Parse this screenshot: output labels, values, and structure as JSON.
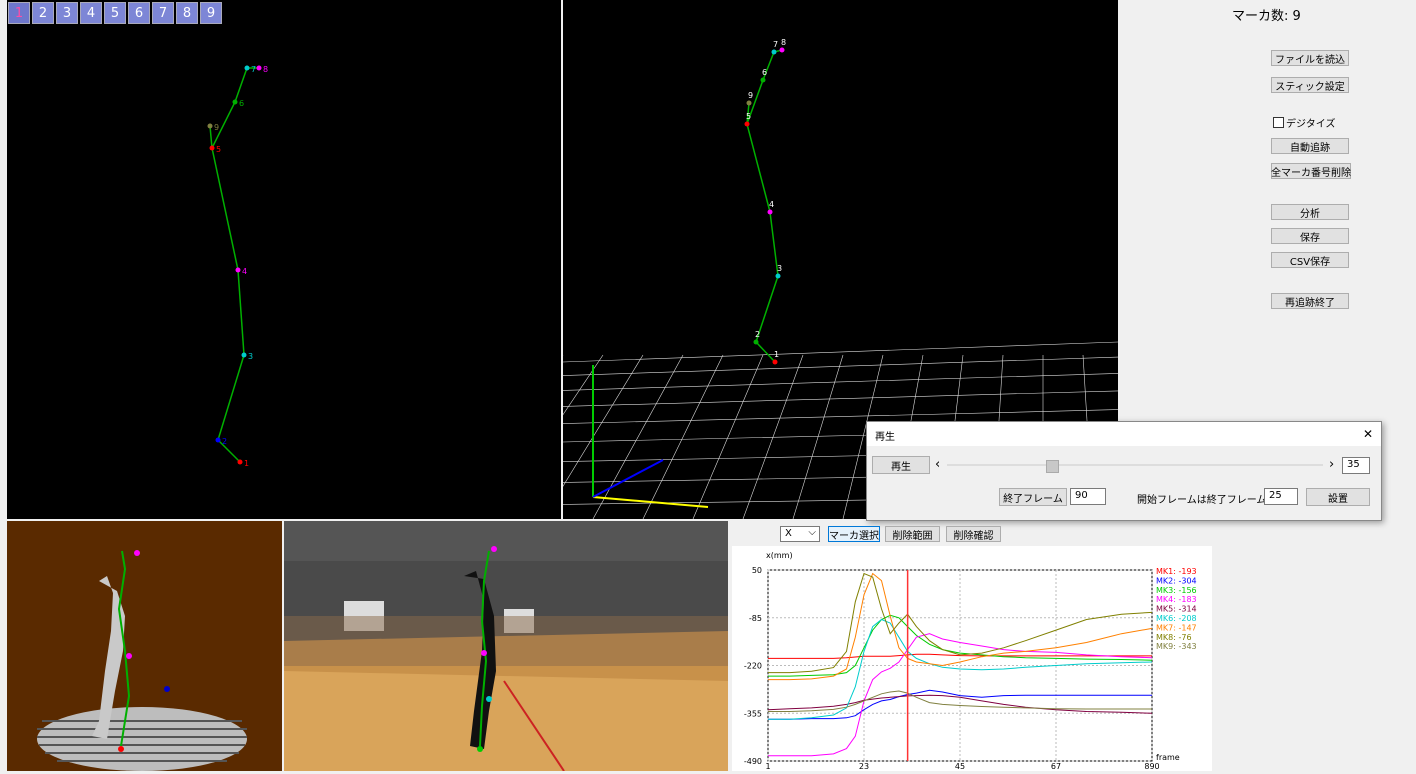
{
  "tabs": [
    "1",
    "2",
    "3",
    "4",
    "5",
    "6",
    "7",
    "8",
    "9"
  ],
  "active_tab": 0,
  "marker_count": {
    "label": "マーカ数:",
    "value": "9"
  },
  "right_panel": {
    "load_file": "ファイルを読込",
    "stick_settings": "スティック設定",
    "digitize_label": "デジタイズ",
    "auto_track": "自動追跡",
    "delete_all_markers": "全マーカ番号削除",
    "analyze": "分析",
    "save": "保存",
    "csv_save": "CSV保存",
    "end_replay": "再追跡終了"
  },
  "playback_dialog": {
    "title": "再生",
    "close": "✕",
    "play_button": "再生",
    "slider_left": "‹",
    "slider_right": "›",
    "slider_value": "35",
    "slider_fraction": 0.27,
    "end_frame_button": "終了フレーム",
    "end_frame_value": "90",
    "start_label": "開始フレームは終了フレーム前",
    "start_value": "25",
    "set_button": "設置"
  },
  "chart_toolbar": {
    "axis_select": "X",
    "marker_select": "マーカ選択",
    "delete_range": "削除範囲",
    "delete_confirm": "削除確認"
  },
  "colors": {
    "mk1": "#ff0000",
    "mk2": "#0000ff",
    "mk3": "#00cc00",
    "mk4": "#ff00ff",
    "mk5": "#800040",
    "mk6": "#00cccc",
    "mk7": "#ff8000",
    "mk8": "#808000",
    "mk9": "#808040",
    "stick": "#00b000"
  },
  "chart_data": {
    "type": "line",
    "ylabel": "x(mm)",
    "xlabel": "frame",
    "x_ticks": [
      "1",
      "23",
      "45",
      "67",
      "890"
    ],
    "y_ticks": [
      50,
      -85,
      -220,
      -355,
      -490
    ],
    "ylim": [
      -490,
      50
    ],
    "x": [
      1,
      6,
      11,
      16,
      19,
      21,
      23,
      25,
      27,
      29,
      31,
      33,
      35,
      38,
      41,
      45,
      50,
      55,
      60,
      67,
      74,
      82,
      89
    ],
    "cursor_frame": 33,
    "legend": [
      {
        "name": "MK1",
        "value": "-193"
      },
      {
        "name": "MK2",
        "value": "-304"
      },
      {
        "name": "MK3",
        "value": "-156"
      },
      {
        "name": "MK4",
        "value": "-183"
      },
      {
        "name": "MK5",
        "value": "-314"
      },
      {
        "name": "MK6",
        "value": "-208"
      },
      {
        "name": "MK7",
        "value": "-147"
      },
      {
        "name": "MK8",
        "value": "-76"
      },
      {
        "name": "MK9",
        "value": "-343"
      }
    ],
    "series": [
      {
        "name": "MK1",
        "values": [
          -200,
          -200,
          -200,
          -200,
          -198,
          -196,
          -194,
          -194,
          -194,
          -194,
          -192,
          -190,
          -188,
          -188,
          -190,
          -192,
          -193,
          -193,
          -193,
          -193,
          -193,
          -193,
          -193
        ]
      },
      {
        "name": "MK2",
        "values": [
          -372,
          -372,
          -370,
          -370,
          -368,
          -362,
          -345,
          -330,
          -320,
          -316,
          -308,
          -302,
          -298,
          -290,
          -295,
          -305,
          -310,
          -305,
          -304,
          -304,
          -304,
          -304,
          -304
        ]
      },
      {
        "name": "MK3",
        "values": [
          -250,
          -250,
          -248,
          -246,
          -240,
          -220,
          -170,
          -120,
          -90,
          -78,
          -85,
          -110,
          -135,
          -160,
          -175,
          -185,
          -190,
          -195,
          -198,
          -200,
          -202,
          -203,
          -205
        ]
      },
      {
        "name": "MK4",
        "values": [
          -475,
          -475,
          -475,
          -470,
          -455,
          -420,
          -320,
          -260,
          -238,
          -228,
          -210,
          -175,
          -140,
          -130,
          -145,
          -155,
          -165,
          -175,
          -180,
          -183,
          -190,
          -195,
          -198
        ]
      },
      {
        "name": "MK5",
        "values": [
          -345,
          -342,
          -340,
          -335,
          -330,
          -325,
          -318,
          -315,
          -312,
          -310,
          -308,
          -306,
          -305,
          -304,
          -305,
          -310,
          -320,
          -330,
          -338,
          -345,
          -350,
          -352,
          -355
        ]
      },
      {
        "name": "MK6",
        "values": [
          -372,
          -372,
          -368,
          -360,
          -340,
          -280,
          -180,
          -110,
          -90,
          -100,
          -140,
          -180,
          -200,
          -215,
          -225,
          -230,
          -232,
          -230,
          -225,
          -220,
          -215,
          -212,
          -210
        ]
      },
      {
        "name": "MK7",
        "values": [
          -260,
          -260,
          -258,
          -250,
          -230,
          -140,
          -20,
          40,
          20,
          -80,
          -170,
          -200,
          -210,
          -215,
          -220,
          -210,
          -195,
          -185,
          -180,
          -170,
          -155,
          -130,
          -115
        ]
      },
      {
        "name": "MK8",
        "values": [
          -240,
          -240,
          -236,
          -226,
          -180,
          -40,
          40,
          30,
          -60,
          -130,
          -100,
          -75,
          -110,
          -150,
          -175,
          -190,
          -185,
          -170,
          -150,
          -120,
          -90,
          -75,
          -70
        ]
      },
      {
        "name": "MK9",
        "values": [
          -350,
          -350,
          -348,
          -344,
          -338,
          -330,
          -320,
          -310,
          -300,
          -295,
          -292,
          -298,
          -310,
          -325,
          -330,
          -333,
          -336,
          -338,
          -340,
          -342,
          -343,
          -343,
          -343
        ]
      }
    ]
  }
}
